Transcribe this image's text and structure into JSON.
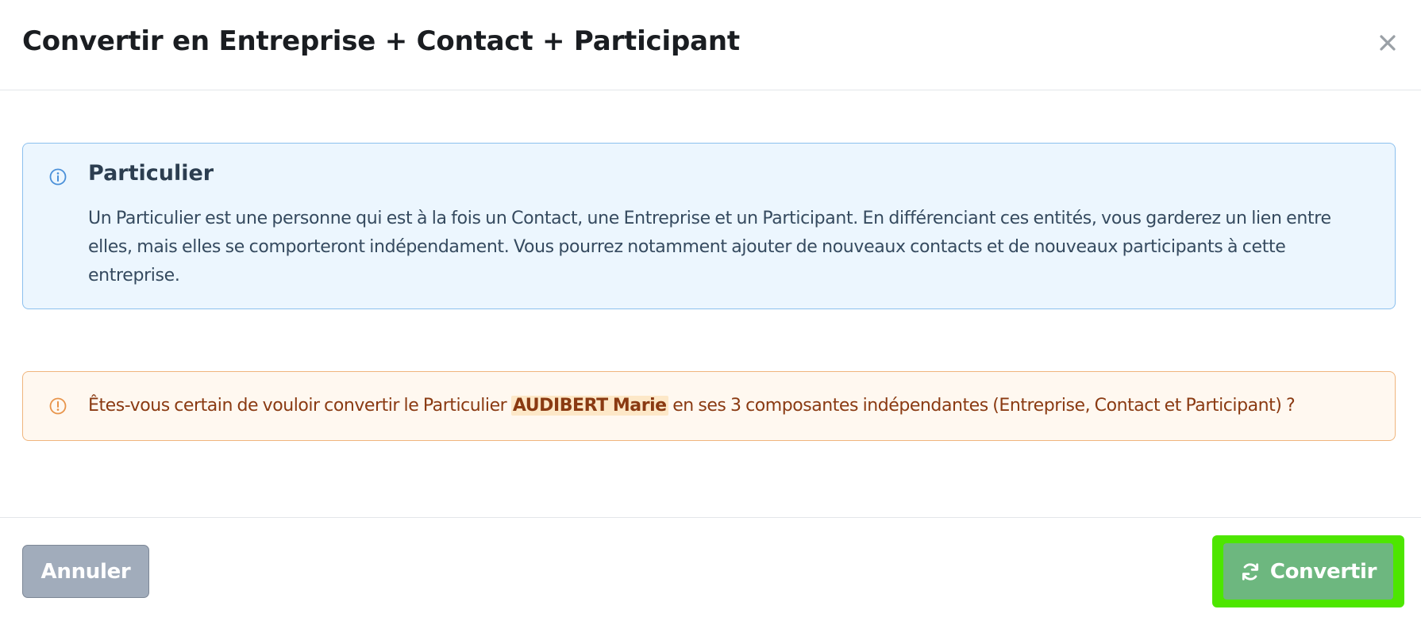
{
  "modal": {
    "title": "Convertir en Entreprise + Contact + Participant",
    "close_icon": "close-icon"
  },
  "info_alert": {
    "icon": "info-icon",
    "title": "Particulier",
    "body": "Un Particulier est une personne qui est à la fois un Contact, une Entreprise et un Participant. En différenciant ces entités, vous garderez un lien entre elles, mais elles se comporteront indépendament. Vous pourrez notamment ajouter de nouveaux contacts et de nouveaux participants à cette entreprise."
  },
  "warning_alert": {
    "icon": "warning-icon",
    "text_before": "Êtes-vous certain de vouloir convertir le Particulier ",
    "name": "AUDIBERT Marie",
    "text_after": " en ses 3 composantes indépendantes (Entreprise, Contact et Participant) ?"
  },
  "footer": {
    "cancel_label": "Annuler",
    "convert_label": "Convertir",
    "convert_icon": "refresh-icon"
  },
  "colors": {
    "info_background": "#ecf6fe",
    "info_border": "#8cc0ee",
    "warning_background": "#fff8f0",
    "warning_border": "#f0b57d",
    "warning_text": "#8a3a12",
    "cancel_button": "#a1acbb",
    "convert_button": "#6db77f",
    "convert_highlight": "#4de600"
  }
}
